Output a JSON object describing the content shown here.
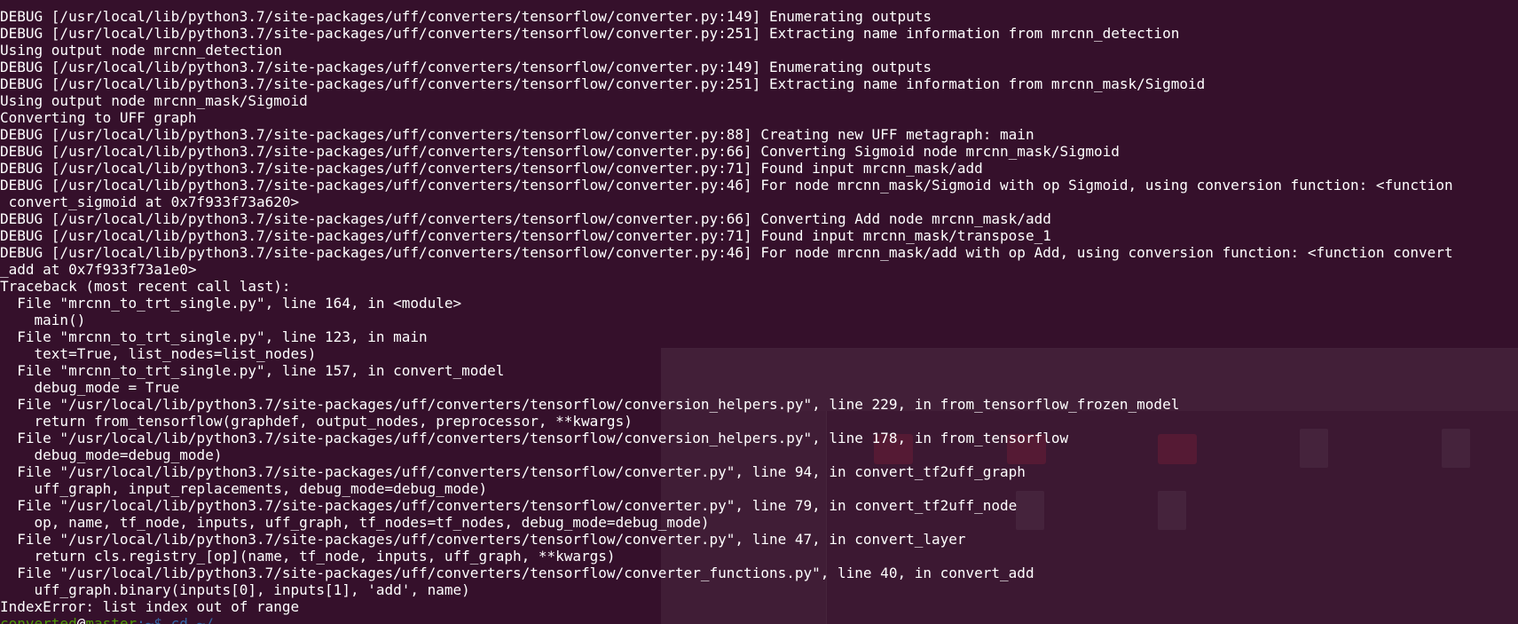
{
  "terminal": {
    "lines": [
      "DEBUG [/usr/local/lib/python3.7/site-packages/uff/converters/tensorflow/converter.py:149] Enumerating outputs",
      "DEBUG [/usr/local/lib/python3.7/site-packages/uff/converters/tensorflow/converter.py:251] Extracting name information from mrcnn_detection",
      "Using output node mrcnn_detection",
      "DEBUG [/usr/local/lib/python3.7/site-packages/uff/converters/tensorflow/converter.py:149] Enumerating outputs",
      "DEBUG [/usr/local/lib/python3.7/site-packages/uff/converters/tensorflow/converter.py:251] Extracting name information from mrcnn_mask/Sigmoid",
      "Using output node mrcnn_mask/Sigmoid",
      "Converting to UFF graph",
      "DEBUG [/usr/local/lib/python3.7/site-packages/uff/converters/tensorflow/converter.py:88] Creating new UFF metagraph: main",
      "DEBUG [/usr/local/lib/python3.7/site-packages/uff/converters/tensorflow/converter.py:66] Converting Sigmoid node mrcnn_mask/Sigmoid",
      "DEBUG [/usr/local/lib/python3.7/site-packages/uff/converters/tensorflow/converter.py:71] Found input mrcnn_mask/add",
      "DEBUG [/usr/local/lib/python3.7/site-packages/uff/converters/tensorflow/converter.py:46] For node mrcnn_mask/Sigmoid with op Sigmoid, using conversion function: <function",
      " convert_sigmoid at 0x7f933f73a620>",
      "DEBUG [/usr/local/lib/python3.7/site-packages/uff/converters/tensorflow/converter.py:66] Converting Add node mrcnn_mask/add",
      "DEBUG [/usr/local/lib/python3.7/site-packages/uff/converters/tensorflow/converter.py:71] Found input mrcnn_mask/transpose_1",
      "DEBUG [/usr/local/lib/python3.7/site-packages/uff/converters/tensorflow/converter.py:46] For node mrcnn_mask/add with op Add, using conversion function: <function convert",
      "_add at 0x7f933f73a1e0>",
      "Traceback (most recent call last):",
      "  File \"mrcnn_to_trt_single.py\", line 164, in <module>",
      "    main()",
      "  File \"mrcnn_to_trt_single.py\", line 123, in main",
      "    text=True, list_nodes=list_nodes)",
      "  File \"mrcnn_to_trt_single.py\", line 157, in convert_model",
      "    debug_mode = True",
      "  File \"/usr/local/lib/python3.7/site-packages/uff/converters/tensorflow/conversion_helpers.py\", line 229, in from_tensorflow_frozen_model",
      "    return from_tensorflow(graphdef, output_nodes, preprocessor, **kwargs)",
      "  File \"/usr/local/lib/python3.7/site-packages/uff/converters/tensorflow/conversion_helpers.py\", line 178, in from_tensorflow",
      "    debug_mode=debug_mode)",
      "  File \"/usr/local/lib/python3.7/site-packages/uff/converters/tensorflow/converter.py\", line 94, in convert_tf2uff_graph",
      "    uff_graph, input_replacements, debug_mode=debug_mode)",
      "  File \"/usr/local/lib/python3.7/site-packages/uff/converters/tensorflow/converter.py\", line 79, in convert_tf2uff_node",
      "    op, name, tf_node, inputs, uff_graph, tf_nodes=tf_nodes, debug_mode=debug_mode)",
      "  File \"/usr/local/lib/python3.7/site-packages/uff/converters/tensorflow/converter.py\", line 47, in convert_layer",
      "    return cls.registry_[op](name, tf_node, inputs, uff_graph, **kwargs)",
      "  File \"/usr/local/lib/python3.7/site-packages/uff/converters/tensorflow/converter_functions.py\", line 40, in convert_add",
      "    uff_graph.binary(inputs[0], inputs[1], 'add', name)",
      "IndexError: list index out of range"
    ],
    "prompt": {
      "user": "converted",
      "separator": "@",
      "host": "master",
      "path": ":~$ cd ~/"
    },
    "colors": {
      "background": "#35102b",
      "text": "#ffffff",
      "prompt_user": "#4e9a06",
      "prompt_path": "#3465a4"
    }
  }
}
